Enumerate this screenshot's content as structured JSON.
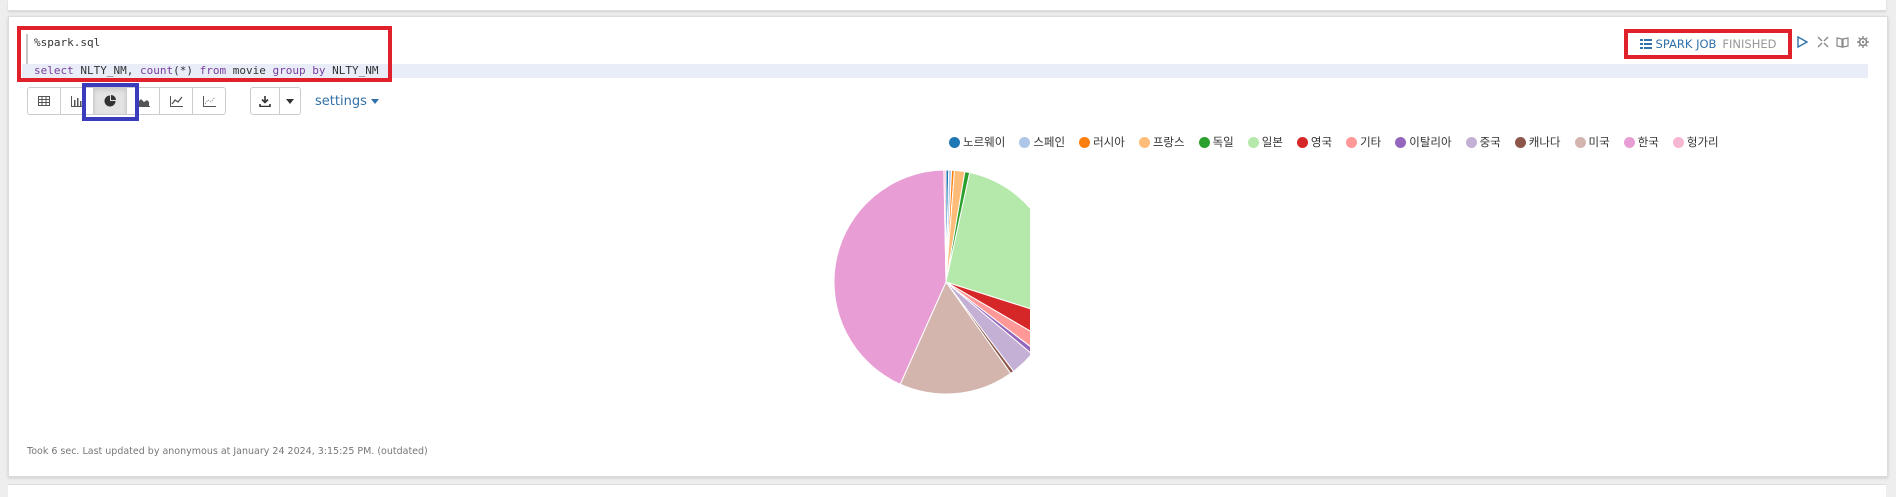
{
  "editor": {
    "line1": "%spark.sql",
    "query": {
      "select": "select",
      "col": " NLTY_NM, ",
      "count": "count",
      "star": "(*) ",
      "from": "from",
      "table": " movie ",
      "group": "group",
      "by": " by",
      "groupcol": " NLTY_NM"
    }
  },
  "status": {
    "job_label": "SPARK JOB",
    "state": "FINISHED"
  },
  "toolbar": {
    "buttons": [
      "table-icon",
      "bar-chart-icon",
      "pie-chart-icon",
      "area-chart-icon",
      "line-chart-icon",
      "scatter-chart-icon"
    ],
    "active": "pie-chart-icon",
    "settings_label": "settings"
  },
  "chart_data": {
    "type": "pie",
    "categories": [
      "노르웨이",
      "스페인",
      "러시아",
      "프랑스",
      "독일",
      "일본",
      "영국",
      "기타",
      "이탈리아",
      "중국",
      "캐나다",
      "미국",
      "한국",
      "헝가리"
    ],
    "values": [
      0.4,
      0.4,
      0.4,
      1.5,
      0.7,
      26.5,
      3.5,
      2.0,
      0.7,
      3.6,
      0.5,
      16.5,
      43.0,
      0.3
    ],
    "colors": [
      "#1f77b4",
      "#aec7e8",
      "#ff7f0e",
      "#ffbb78",
      "#2ca02c",
      "#b5e8ab",
      "#d62728",
      "#ff9896",
      "#9467bd",
      "#c5b0d5",
      "#8c564b",
      "#d4b5ae",
      "#e89dd4",
      "#f7b6d2"
    ],
    "legend_position": "top-right"
  },
  "footer": {
    "text": "Took 6 sec. Last updated by anonymous at January 24 2024, 3:15:25 PM. (outdated)"
  }
}
